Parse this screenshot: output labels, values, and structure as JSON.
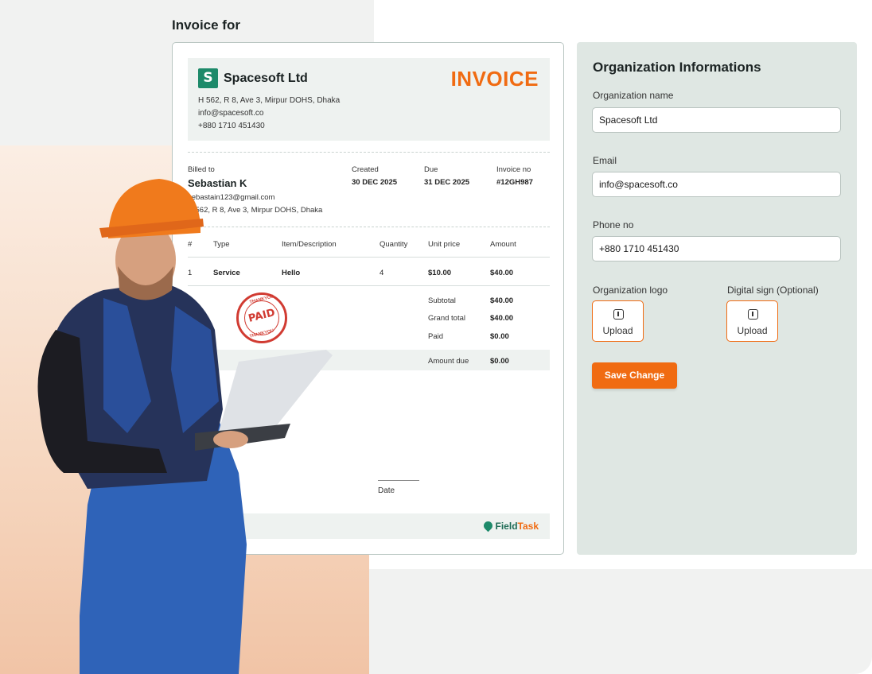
{
  "page": {
    "title": "Invoice for"
  },
  "invoice": {
    "company": {
      "name": "Spacesoft Ltd",
      "logo_letter": "S",
      "address": "H 562, R 8, Ave 3, Mirpur DOHS, Dhaka",
      "email": "info@spacesoft.co",
      "phone": "+880 1710 451430"
    },
    "heading": "INVOICE",
    "billed_to": {
      "label": "Billed to",
      "name": "Sebastian K",
      "email": "sebastain123@gmail.com",
      "address": "H 562, R 8, Ave 3, Mirpur DOHS, Dhaka"
    },
    "created": {
      "label": "Created",
      "value": "30 DEC 2025"
    },
    "due": {
      "label": "Due",
      "value": "31 DEC 2025"
    },
    "invoice_no": {
      "label": "Invoice no",
      "value": "#12GH987"
    },
    "table": {
      "headers": [
        "#",
        "Type",
        "Item/Description",
        "Quantity",
        "Unit price",
        "Amount"
      ],
      "rows": [
        [
          "1",
          "Service",
          "Hello",
          "4",
          "$10.00",
          "$40.00"
        ]
      ]
    },
    "summary": {
      "subtotal_label": "Subtotal",
      "subtotal": "$40.00",
      "grand_total_label": "Grand total",
      "grand_total": "$40.00",
      "paid_label": "Paid",
      "paid": "$0.00",
      "amount_due_label": "Amount due",
      "amount_due": "$0.00"
    },
    "stamp": {
      "top": "THANKYOU",
      "main": "PAID",
      "bottom": "THANKYOU"
    },
    "date_label": "Date",
    "footer": {
      "by_text": "by",
      "brand_a": "Field",
      "brand_b": "Task"
    }
  },
  "org": {
    "title": "Organization Informations",
    "name_label": "Organization name",
    "name_value": "Spacesoft Ltd",
    "email_label": "Email",
    "email_value": "info@spacesoft.co",
    "phone_label": "Phone no",
    "phone_value": "+880 1710 451430",
    "logo_label": "Organization logo",
    "sign_label": "Digital sign (Optional)",
    "upload_label": "Upload",
    "save_label": "Save Change"
  },
  "colors": {
    "accent": "#f06b12",
    "brand_green": "#1d8a6a",
    "panel": "#dfe7e3",
    "stamp": "#d13b32"
  }
}
